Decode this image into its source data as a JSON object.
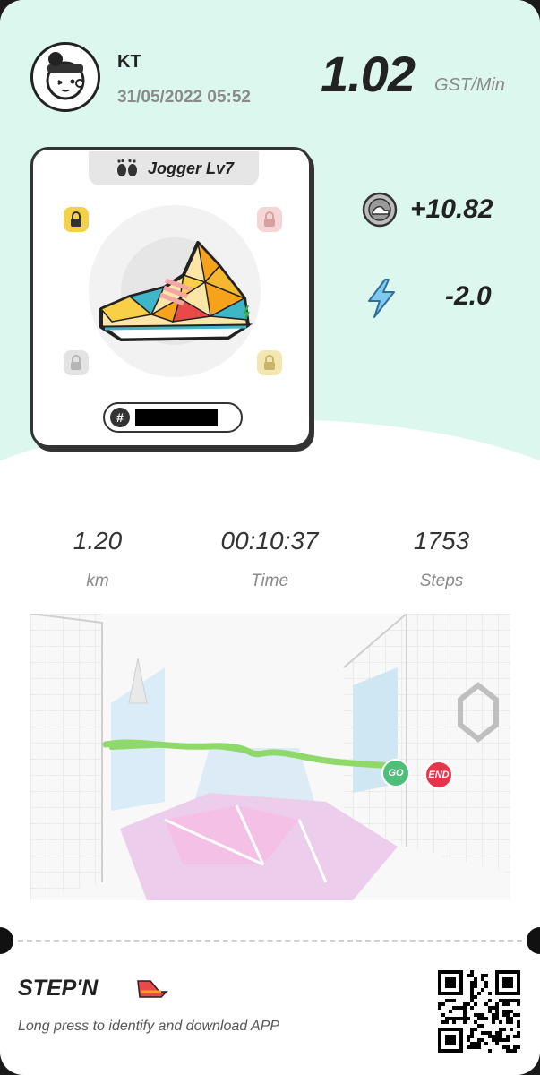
{
  "header": {
    "username": "KT",
    "datetime": "31/05/2022 05:52",
    "rate_value": "1.02",
    "rate_unit": "GST/Min"
  },
  "sneaker": {
    "type_label": "Jogger Lv7",
    "id_prefix": "#",
    "gem_sockets": [
      "lock-icon",
      "lock-icon",
      "lock-icon",
      "lock-icon"
    ],
    "colors": {
      "primary": "#f7a21b",
      "accent": "#e84a4a",
      "teal": "#3fb6c7"
    }
  },
  "earnings": {
    "gst_earned": "+10.82",
    "energy_used": "-2.0"
  },
  "stats": [
    {
      "value": "1.20",
      "label": "km"
    },
    {
      "value": "00:10:37",
      "label": "Time"
    },
    {
      "value": "1753",
      "label": "Steps"
    }
  ],
  "map": {
    "start_label": "GO",
    "end_label": "END",
    "route_color": "#8fd96a"
  },
  "footer": {
    "brand": "STEP'N",
    "hint": "Long press to identify and download APP"
  },
  "colors": {
    "mint": "#dcf8ee",
    "go": "#4cbf7a",
    "end": "#e8344a"
  }
}
